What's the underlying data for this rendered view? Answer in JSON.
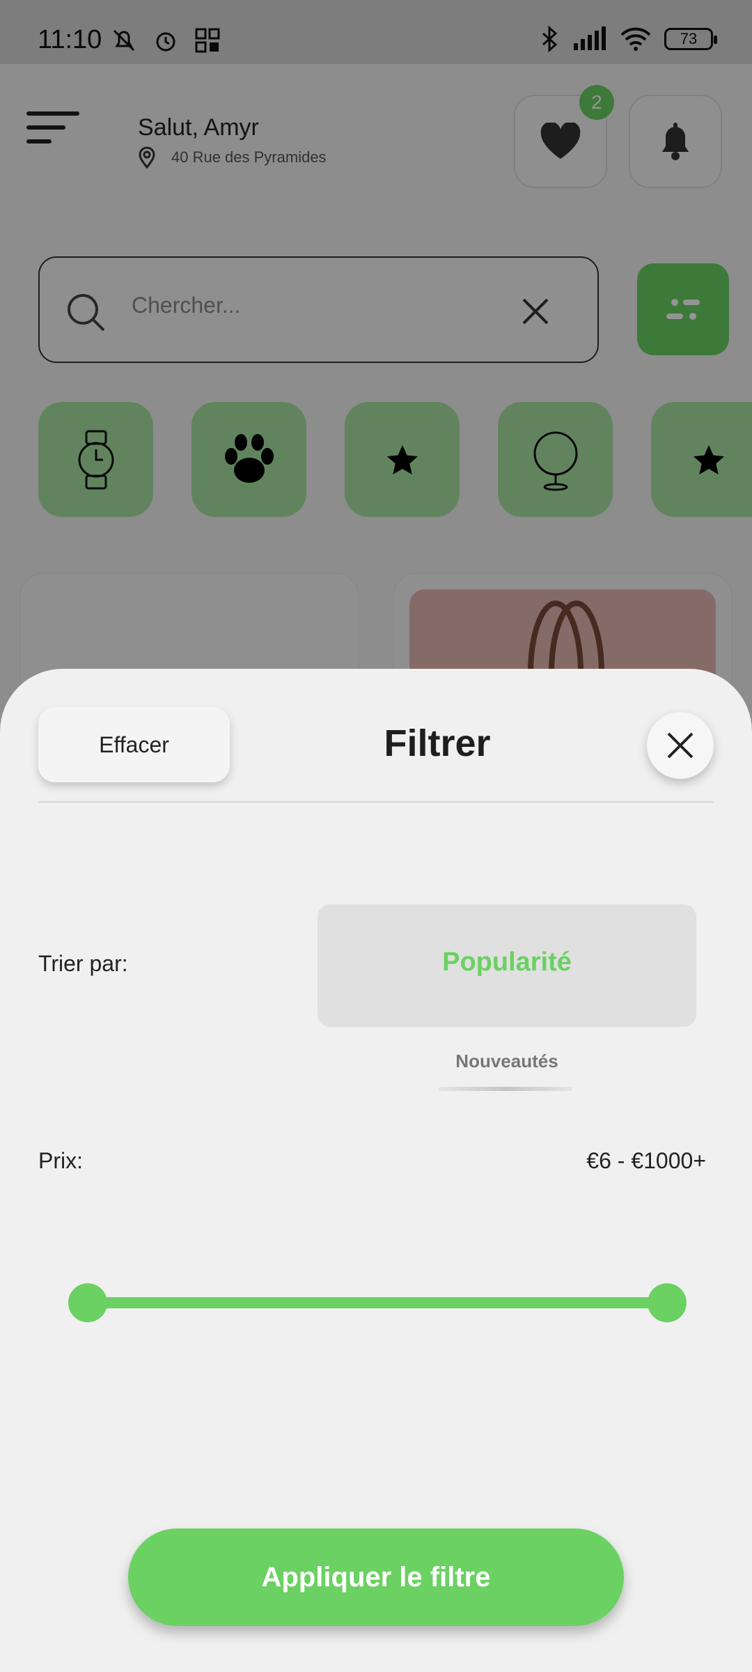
{
  "status_bar": {
    "time": "11:10",
    "battery": "73"
  },
  "header": {
    "greeting": "Salut, Amyr",
    "address": "40 Rue des Pyramides",
    "favorites_badge": "2"
  },
  "search": {
    "placeholder": "Chercher..."
  },
  "categories": [
    {
      "icon": "watch-icon"
    },
    {
      "icon": "paw-icon"
    },
    {
      "icon": "star-icon"
    },
    {
      "icon": "mirror-icon"
    },
    {
      "icon": "star-icon"
    }
  ],
  "sheet": {
    "title": "Filtrer",
    "clear_label": "Effacer",
    "sort_label": "Trier par:",
    "sort_options": [
      "Popularité",
      "Nouveautés"
    ],
    "sort_selected": "Popularité",
    "price_label": "Prix:",
    "price_range": "€6 - €1000+",
    "price_min_fraction": 0.0,
    "price_max_fraction": 1.0,
    "apply_label": "Appliquer le filtre"
  },
  "colors": {
    "accent": "#6ad162",
    "category_bg": "#a7e4a2"
  }
}
